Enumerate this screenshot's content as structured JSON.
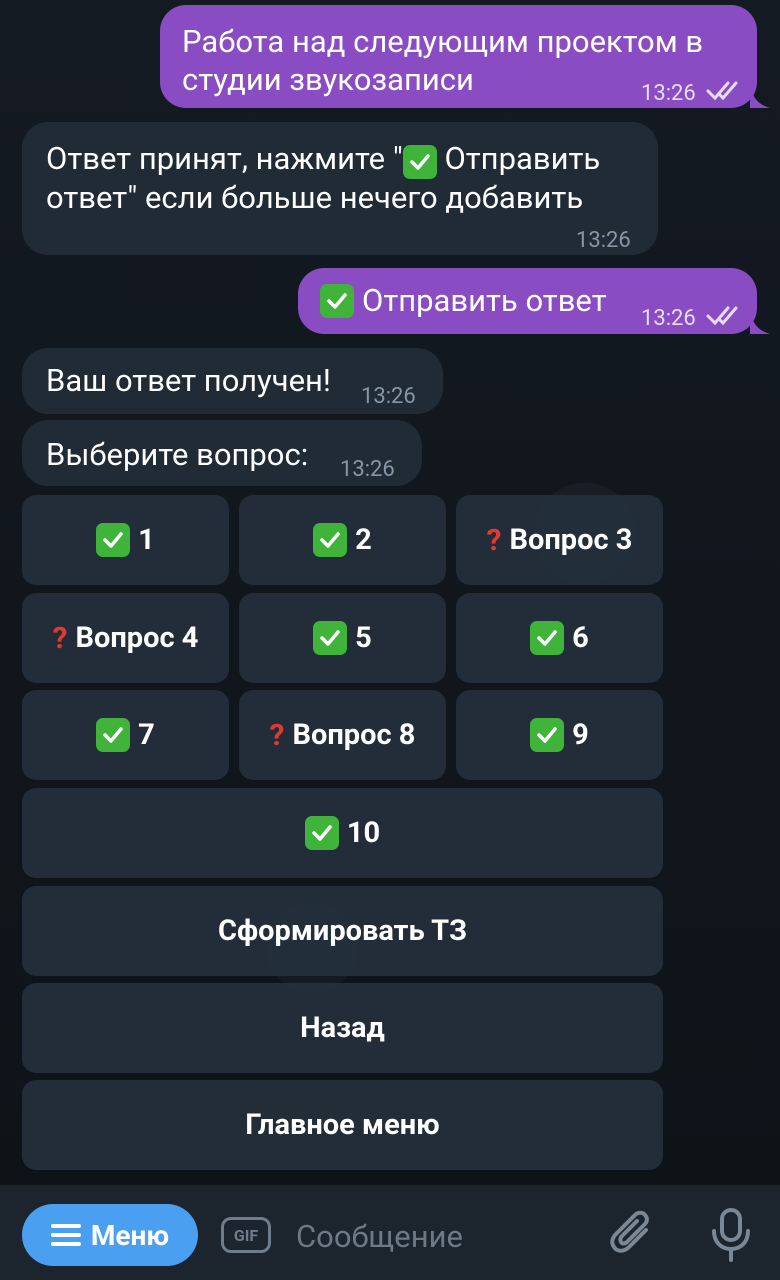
{
  "colors": {
    "outgoing": "#8a4cc3",
    "incoming": "#212b36",
    "accent": "#4a9ff0",
    "check": "#3fb33a",
    "question": "#e0392f"
  },
  "messages": [
    {
      "direction": "out",
      "line1": "Работа над следующим проектом в",
      "line2": "студии звукозаписи",
      "time": "13:26",
      "status": "read-double-check-icon"
    },
    {
      "direction": "in",
      "line1_pre": "Ответ принят, нажмите \"",
      "line1_post": " Отправить",
      "line2": "ответ\" если больше нечего добавить",
      "time": "13:26"
    },
    {
      "direction": "out",
      "text": "Отправить ответ",
      "time": "13:26",
      "status": "read-double-check-icon"
    },
    {
      "direction": "in",
      "text": "Ваш ответ получен!",
      "time": "13:26"
    },
    {
      "direction": "in",
      "text": "Выберите вопрос:",
      "time": "13:26"
    }
  ],
  "keyboard": {
    "rows": [
      [
        {
          "icon": "check-mark-icon",
          "label": "1"
        },
        {
          "icon": "check-mark-icon",
          "label": "2"
        },
        {
          "icon": "question-mark-icon",
          "label": "Вопрос 3"
        }
      ],
      [
        {
          "icon": "question-mark-icon",
          "label": "Вопрос 4"
        },
        {
          "icon": "check-mark-icon",
          "label": "5"
        },
        {
          "icon": "check-mark-icon",
          "label": "6"
        }
      ],
      [
        {
          "icon": "check-mark-icon",
          "label": "7"
        },
        {
          "icon": "question-mark-icon",
          "label": "Вопрос 8"
        },
        {
          "icon": "check-mark-icon",
          "label": "9"
        }
      ],
      [
        {
          "icon": "check-mark-icon",
          "label": "10"
        }
      ]
    ],
    "form_tz": "Сформировать ТЗ",
    "back": "Назад",
    "main_menu": "Главное меню"
  },
  "composer": {
    "menu_label": "Меню",
    "gif_label": "GIF",
    "placeholder": "Сообщение",
    "attach_icon": "paperclip-icon",
    "mic_icon": "microphone-icon"
  }
}
